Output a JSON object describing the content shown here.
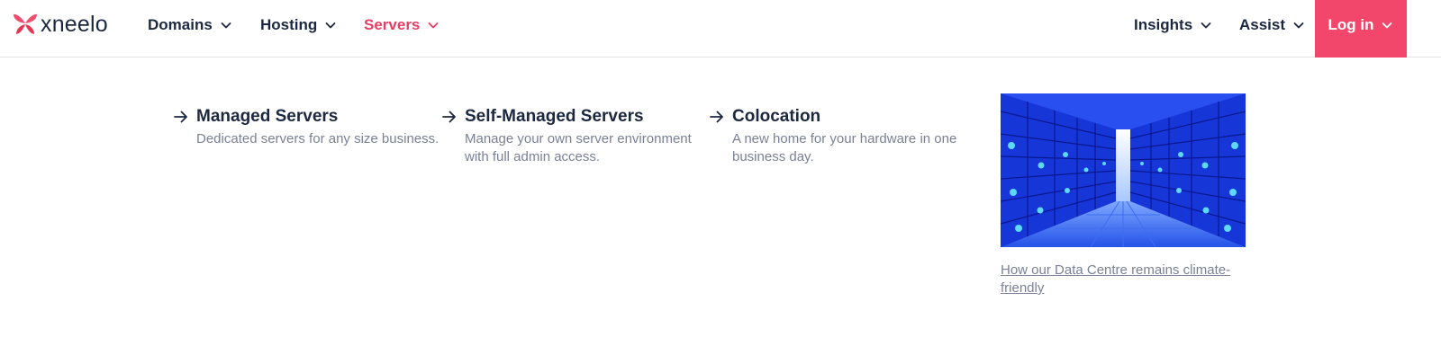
{
  "brand": {
    "name": "xneelo",
    "logo_icon": "butterfly-logo-icon",
    "colors": {
      "accent": "#f2466a",
      "active_nav": "#e83e63",
      "text_dark": "#1c2740",
      "text_muted": "#7a8196",
      "logo_pink": "#f04e6e",
      "logo_red": "#e8334f"
    }
  },
  "nav": {
    "items": [
      {
        "label": "Domains",
        "icon": "chevron-down-icon",
        "active": false
      },
      {
        "label": "Hosting",
        "icon": "chevron-down-icon",
        "active": false
      },
      {
        "label": "Servers",
        "icon": "chevron-down-icon",
        "active": true
      },
      {
        "label": "Insights",
        "icon": "chevron-down-icon",
        "active": false
      },
      {
        "label": "Assist",
        "icon": "chevron-down-icon",
        "active": false
      }
    ],
    "login": {
      "label": "Log in",
      "icon": "chevron-down-icon"
    }
  },
  "mega_menu": {
    "items": [
      {
        "title": "Managed Servers",
        "description": "Dedicated servers for any size business.",
        "icon": "arrow-right-icon"
      },
      {
        "title": "Self-Managed Servers",
        "description": "Manage your own server environment with full admin access.",
        "icon": "arrow-right-icon"
      },
      {
        "title": "Colocation",
        "description": "A new home for your hardware in one business day.",
        "icon": "arrow-right-icon"
      }
    ],
    "feature": {
      "image": "data-centre-server-aisle-image",
      "link_text": "How our Data Centre remains climate-friendly"
    }
  }
}
